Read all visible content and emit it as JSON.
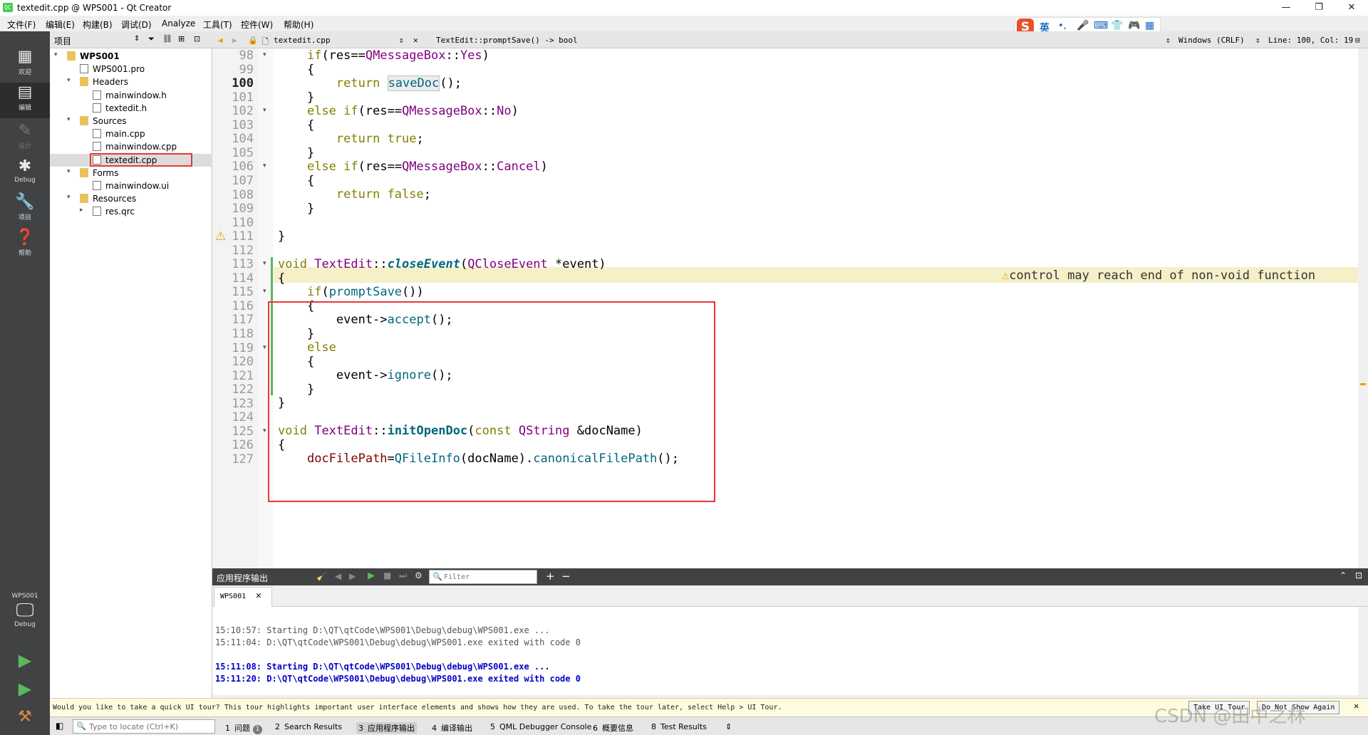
{
  "window": {
    "title": "textedit.cpp @ WPS001 - Qt Creator",
    "app_icon": "QC",
    "minimize": "—",
    "maximize": "❐",
    "close": "✕"
  },
  "menu": [
    "文件(F)",
    "编辑(E)",
    "构建(B)",
    "调试(D)",
    "Analyze",
    "工具(T)",
    "控件(W)",
    "帮助(H)"
  ],
  "ime": {
    "logo": "S",
    "lang": "英",
    "items": [
      "•,",
      "🎤",
      "⌨",
      "👕",
      "🎮",
      "▦"
    ]
  },
  "modes": [
    {
      "label": "欢迎",
      "icon": "grid-icon"
    },
    {
      "label": "编辑",
      "icon": "edit-icon"
    },
    {
      "label": "设计",
      "icon": "pen-icon"
    },
    {
      "label": "Debug",
      "icon": "bug-icon"
    },
    {
      "label": "项目",
      "icon": "wrench-icon"
    },
    {
      "label": "帮助",
      "icon": "help-icon"
    }
  ],
  "kit": {
    "project": "WPS001",
    "config": "Debug"
  },
  "project_panel": {
    "title": "项目",
    "tree": [
      {
        "label": "WPS001",
        "depth": 0,
        "kind": "project",
        "expanded": true,
        "bold": true
      },
      {
        "label": "WPS001.pro",
        "depth": 1,
        "kind": "file"
      },
      {
        "label": "Headers",
        "depth": 1,
        "kind": "folder",
        "expanded": true
      },
      {
        "label": "mainwindow.h",
        "depth": 2,
        "kind": "file"
      },
      {
        "label": "textedit.h",
        "depth": 2,
        "kind": "file"
      },
      {
        "label": "Sources",
        "depth": 1,
        "kind": "folder",
        "expanded": true
      },
      {
        "label": "main.cpp",
        "depth": 2,
        "kind": "file"
      },
      {
        "label": "mainwindow.cpp",
        "depth": 2,
        "kind": "file"
      },
      {
        "label": "textedit.cpp",
        "depth": 2,
        "kind": "file",
        "selected": true
      },
      {
        "label": "Forms",
        "depth": 1,
        "kind": "folder",
        "expanded": true
      },
      {
        "label": "mainwindow.ui",
        "depth": 2,
        "kind": "file"
      },
      {
        "label": "Resources",
        "depth": 1,
        "kind": "folder",
        "expanded": true
      },
      {
        "label": "res.qrc",
        "depth": 2,
        "kind": "file",
        "collapsed": true
      }
    ]
  },
  "editor_toolbar": {
    "file": "textedit.cpp",
    "symbol": "TextEdit::promptSave() -> bool",
    "encoding": "Windows (CRLF)",
    "position": "Line: 100, Col: 19"
  },
  "editor": {
    "current_line": "100",
    "warning": "control may reach end of non-void function",
    "lines": [
      {
        "n": "98",
        "fold": true
      },
      {
        "n": "99"
      },
      {
        "n": "100"
      },
      {
        "n": "101"
      },
      {
        "n": "102",
        "fold": true
      },
      {
        "n": "103"
      },
      {
        "n": "104"
      },
      {
        "n": "105"
      },
      {
        "n": "106",
        "fold": true
      },
      {
        "n": "107"
      },
      {
        "n": "108"
      },
      {
        "n": "109"
      },
      {
        "n": "110"
      },
      {
        "n": "111",
        "warn": true
      },
      {
        "n": "112"
      },
      {
        "n": "113",
        "fold": true
      },
      {
        "n": "114"
      },
      {
        "n": "115",
        "fold": true
      },
      {
        "n": "116"
      },
      {
        "n": "117"
      },
      {
        "n": "118"
      },
      {
        "n": "119",
        "fold": true
      },
      {
        "n": "120"
      },
      {
        "n": "121"
      },
      {
        "n": "122"
      },
      {
        "n": "123"
      },
      {
        "n": "124"
      },
      {
        "n": "125",
        "fold": true
      },
      {
        "n": "126"
      },
      {
        "n": "127"
      }
    ]
  },
  "output_pane": {
    "title": "应用程序输出",
    "filter_placeholder": "Filter",
    "tab": "WPS001",
    "lines": [
      {
        "text": "15:10:57: Starting D:\\QT\\qtCode\\WPS001\\Debug\\debug\\WPS001.exe ...",
        "bold": false
      },
      {
        "text": "15:11:04: D:\\QT\\qtCode\\WPS001\\Debug\\debug\\WPS001.exe exited with code 0",
        "bold": false
      },
      {
        "text": "",
        "bold": false
      },
      {
        "text": "15:11:08: Starting D:\\QT\\qtCode\\WPS001\\Debug\\debug\\WPS001.exe ...",
        "bold": true
      },
      {
        "text": "15:11:20: D:\\QT\\qtCode\\WPS001\\Debug\\debug\\WPS001.exe exited with code 0",
        "bold": true
      }
    ]
  },
  "tour": {
    "message": "Would you like to take a quick UI tour? This tour highlights important user interface elements and shows how they are used. To take the tour later, select Help > UI Tour.",
    "take_button": "Take UI Tour",
    "dismiss_button": "Do Not Show Again"
  },
  "statusbar": {
    "locate_placeholder": "Type to locate (Ctrl+K)",
    "tabs": [
      {
        "num": "1",
        "label": "问题",
        "badge": "1"
      },
      {
        "num": "2",
        "label": "Search Results"
      },
      {
        "num": "3",
        "label": "应用程序输出"
      },
      {
        "num": "4",
        "label": "编译输出"
      },
      {
        "num": "5",
        "label": "QML Debugger Console"
      },
      {
        "num": "6",
        "label": "概要信息"
      },
      {
        "num": "8",
        "label": "Test Results"
      }
    ]
  },
  "watermark": "CSDN @田中之林",
  "colors": {
    "highlight": "#e53935",
    "sidebar": "#404244",
    "keyword": "#808000",
    "function": "#00677c",
    "type": "#800080"
  }
}
